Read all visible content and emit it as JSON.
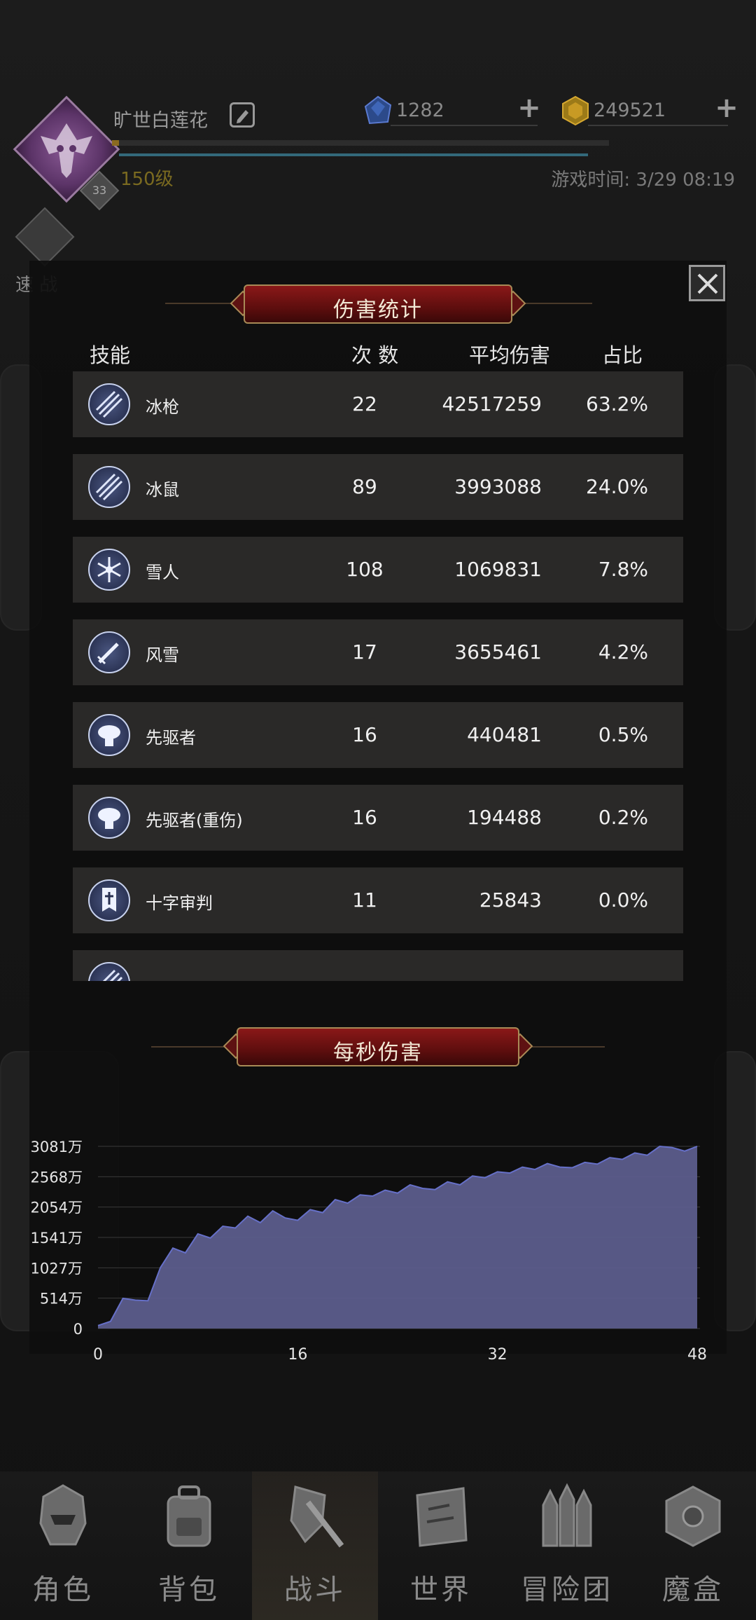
{
  "header": {
    "player_name": "旷世白莲花",
    "avatar_badge": "33",
    "level": "150级",
    "game_time": "游戏时间: 3/29 08:19",
    "diamonds": "1282",
    "gold": "249521"
  },
  "quick_battle": {
    "label": "速 战"
  },
  "damage_stats": {
    "title": "伤害统计",
    "columns": {
      "skill": "技能",
      "count": "次 数",
      "avg": "平均伤害",
      "share": "占比"
    },
    "rows": [
      {
        "icon": "ice-spear-icon",
        "name": "冰枪",
        "count": "22",
        "avg": "42517259",
        "share": "63.2%"
      },
      {
        "icon": "ice-spear-icon",
        "name": "冰鼠",
        "count": "89",
        "avg": "3993088",
        "share": "24.0%"
      },
      {
        "icon": "snowflake-icon",
        "name": "雪人",
        "count": "108",
        "avg": "1069831",
        "share": "7.8%"
      },
      {
        "icon": "sword-icon",
        "name": "风雪",
        "count": "17",
        "avg": "3655461",
        "share": "4.2%"
      },
      {
        "icon": "explosion-icon",
        "name": "先驱者",
        "count": "16",
        "avg": "440481",
        "share": "0.5%"
      },
      {
        "icon": "explosion-icon",
        "name": "先驱者(重伤)",
        "count": "16",
        "avg": "194488",
        "share": "0.2%"
      },
      {
        "icon": "cross-banner-icon",
        "name": "十字审判",
        "count": "11",
        "avg": "25843",
        "share": "0.0%"
      },
      {
        "icon": "ice-spear-icon",
        "name": "",
        "count": "",
        "avg": "",
        "share": ""
      }
    ]
  },
  "dps": {
    "title": "每秒伤害"
  },
  "chart_data": {
    "type": "area",
    "title": "每秒伤害",
    "xlabel": "",
    "ylabel": "",
    "xlim": [
      0,
      48
    ],
    "x_ticks": [
      "0",
      "16",
      "32",
      "48"
    ],
    "ylim": [
      0,
      3081
    ],
    "y_ticks": [
      "0",
      "514万",
      "1027万",
      "1541万",
      "2054万",
      "2568万",
      "3081万"
    ],
    "grid": true,
    "colors": {
      "fill": "#5c5d8c",
      "line": "#6670c8"
    },
    "x": [
      0,
      1,
      2,
      3,
      4,
      5,
      6,
      7,
      8,
      9,
      10,
      11,
      12,
      13,
      14,
      15,
      16,
      17,
      18,
      19,
      20,
      21,
      22,
      23,
      24,
      25,
      26,
      27,
      28,
      29,
      30,
      31,
      32,
      33,
      34,
      35,
      36,
      37,
      38,
      39,
      40,
      41,
      42,
      43,
      44,
      45,
      46,
      47,
      48
    ],
    "series": [
      {
        "values": [
          50,
          120,
          510,
          480,
          470,
          1030,
          1360,
          1280,
          1600,
          1530,
          1730,
          1700,
          1900,
          1790,
          1990,
          1870,
          1830,
          2010,
          1960,
          2180,
          2120,
          2260,
          2240,
          2340,
          2290,
          2430,
          2370,
          2350,
          2480,
          2430,
          2580,
          2550,
          2650,
          2630,
          2730,
          2690,
          2790,
          2730,
          2720,
          2810,
          2780,
          2890,
          2860,
          2970,
          2930,
          3081,
          3060,
          3000,
          3081
        ]
      }
    ]
  },
  "nav": {
    "items": [
      {
        "label": "角色",
        "icon": "helmet-icon"
      },
      {
        "label": "背包",
        "icon": "backpack-icon"
      },
      {
        "label": "战斗",
        "icon": "shield-sword-icon"
      },
      {
        "label": "世界",
        "icon": "map-scroll-icon"
      },
      {
        "label": "冒险团",
        "icon": "castle-icon"
      },
      {
        "label": "魔盒",
        "icon": "magic-box-icon"
      }
    ]
  }
}
